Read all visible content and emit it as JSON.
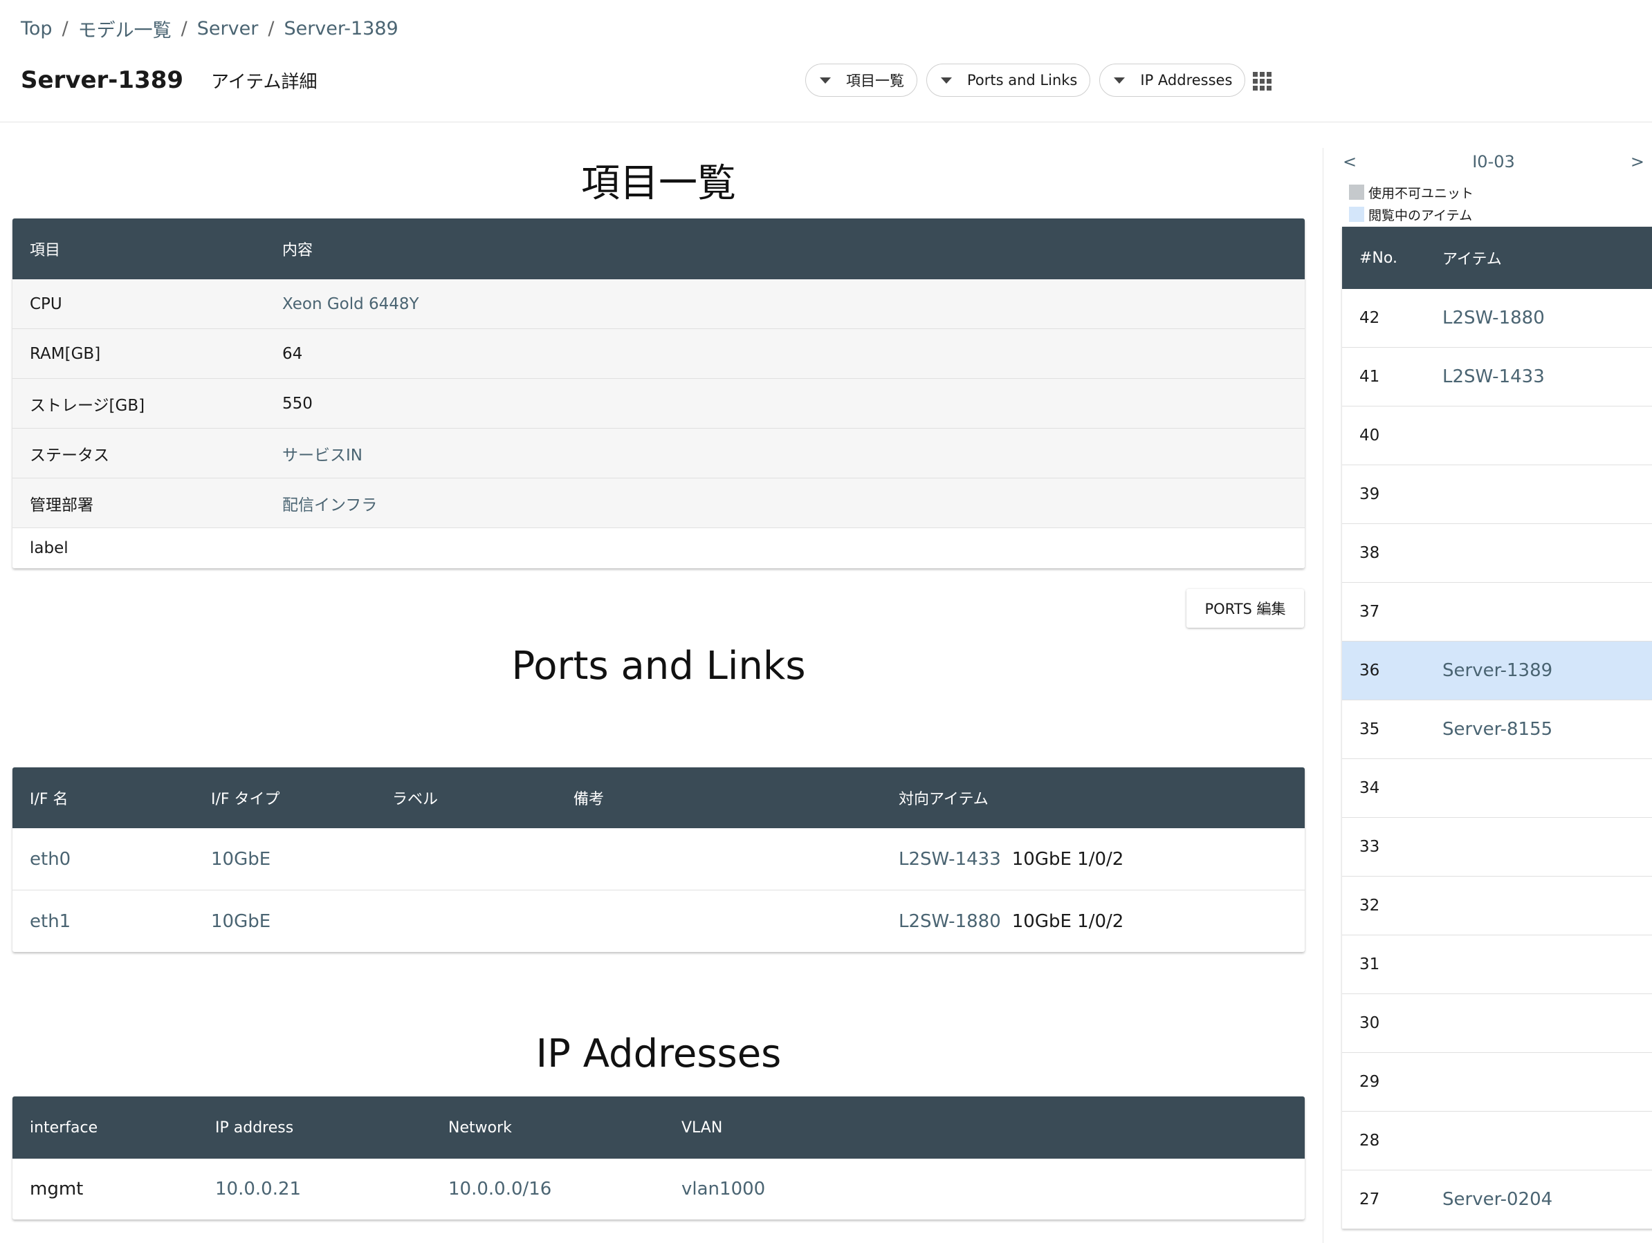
{
  "breadcrumb": [
    "Top",
    "モデル一覧",
    "Server",
    "Server-1389"
  ],
  "page": {
    "title": "Server-1389",
    "subtitle": "アイテム詳細"
  },
  "nav": [
    {
      "label": "項目一覧"
    },
    {
      "label": "Ports and Links"
    },
    {
      "label": "IP Addresses"
    }
  ],
  "items_section": {
    "title": "項目一覧",
    "headers": [
      "項目",
      "内容"
    ],
    "rows": [
      {
        "key": "CPU",
        "value": "Xeon Gold 6448Y",
        "link": true
      },
      {
        "key": "RAM[GB]",
        "value": "64",
        "link": false
      },
      {
        "key": "ストレージ[GB]",
        "value": "550",
        "link": false
      },
      {
        "key": "ステータス",
        "value": "サービスIN",
        "link": true
      },
      {
        "key": "管理部署",
        "value": "配信インフラ",
        "link": true
      },
      {
        "key": "label",
        "value": "",
        "link": false
      }
    ]
  },
  "ports_section": {
    "title": "Ports and Links",
    "edit_button": "PORTS 編集",
    "headers": [
      "I/F 名",
      "I/F タイプ",
      "ラベル",
      "備考",
      "対向アイテム"
    ],
    "rows": [
      {
        "name": "eth0",
        "type": "10GbE",
        "label": "",
        "note": "",
        "peer": "L2SW-1433",
        "peer_port": "10GbE 1/0/2"
      },
      {
        "name": "eth1",
        "type": "10GbE",
        "label": "",
        "note": "",
        "peer": "L2SW-1880",
        "peer_port": "10GbE 1/0/2"
      }
    ]
  },
  "ip_section": {
    "title": "IP Addresses",
    "headers": [
      "interface",
      "IP address",
      "Network",
      "VLAN"
    ],
    "rows": [
      {
        "interface": "mgmt",
        "ip": "10.0.0.21",
        "network": "10.0.0.0/16",
        "vlan": "vlan1000"
      }
    ]
  },
  "rack": {
    "prev": "<",
    "next": ">",
    "name": "I0-03",
    "legend": [
      {
        "label": "使用不可ユニット",
        "color": "#c5c9cc"
      },
      {
        "label": "閲覧中のアイテム",
        "color": "#d4e6fa"
      }
    ],
    "headers": [
      "#No.",
      "アイテム"
    ],
    "units": [
      {
        "no": "42",
        "item": "L2SW-1880",
        "active": false
      },
      {
        "no": "41",
        "item": "L2SW-1433",
        "active": false
      },
      {
        "no": "40",
        "item": "",
        "active": false
      },
      {
        "no": "39",
        "item": "",
        "active": false
      },
      {
        "no": "38",
        "item": "",
        "active": false
      },
      {
        "no": "37",
        "item": "",
        "active": false
      },
      {
        "no": "36",
        "item": "Server-1389",
        "active": true
      },
      {
        "no": "35",
        "item": "Server-8155",
        "active": false
      },
      {
        "no": "34",
        "item": "",
        "active": false
      },
      {
        "no": "33",
        "item": "",
        "active": false
      },
      {
        "no": "32",
        "item": "",
        "active": false
      },
      {
        "no": "31",
        "item": "",
        "active": false
      },
      {
        "no": "30",
        "item": "",
        "active": false
      },
      {
        "no": "29",
        "item": "",
        "active": false
      },
      {
        "no": "28",
        "item": "",
        "active": false
      },
      {
        "no": "27",
        "item": "Server-0204",
        "active": false
      }
    ]
  }
}
